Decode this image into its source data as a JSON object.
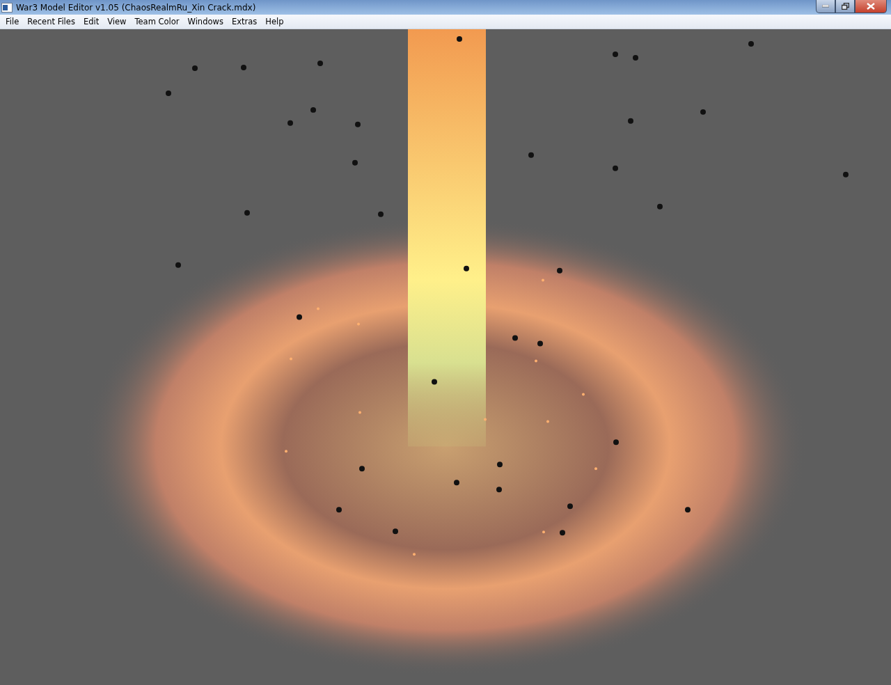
{
  "window": {
    "title": "War3 Model Editor v1.05 (ChaosRealmRu_Xin Crack.mdx)"
  },
  "menu": [
    {
      "label": "File"
    },
    {
      "label": "Recent Files"
    },
    {
      "label": "Edit"
    },
    {
      "label": "View"
    },
    {
      "label": "Team Color"
    },
    {
      "label": "Windows"
    },
    {
      "label": "Extras"
    },
    {
      "label": "Help"
    }
  ]
}
